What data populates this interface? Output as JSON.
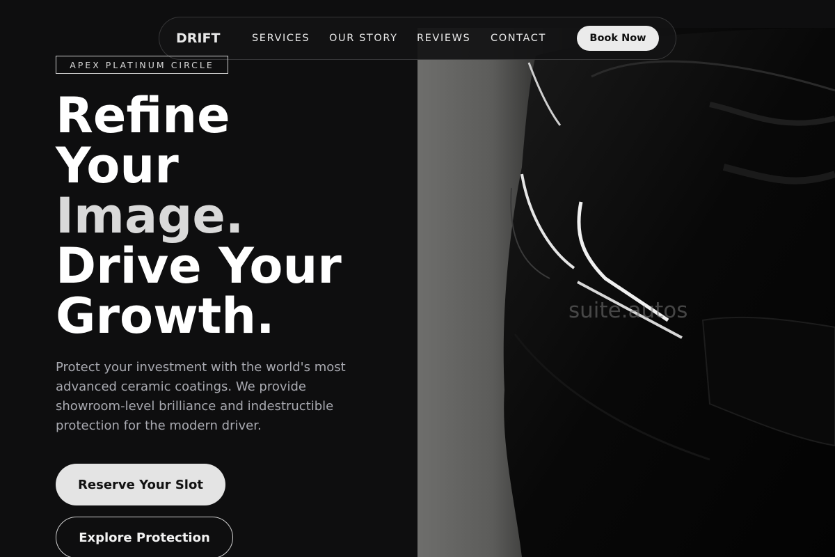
{
  "nav": {
    "logo": "DRIFT",
    "links": [
      "SERVICES",
      "OUR STORY",
      "REVIEWS",
      "CONTACT"
    ],
    "cta": "Book Now"
  },
  "hero": {
    "badge": "APEX PLATINUM CIRCLE",
    "headline_lines": [
      "Refine",
      "Your",
      "Image.",
      "Drive Your",
      "Growth."
    ],
    "description": "Protect your investment with the world's most advanced ceramic coatings. We provide showroom-level brilliance and indestructible protection for the modern driver.",
    "primary_cta": "Reserve Your Slot",
    "secondary_cta": "Explore Protection",
    "image_watermark": "suite.autos",
    "image_subject": "black-car-headlight-photo"
  },
  "colors": {
    "background": "#0e0e0f",
    "text_primary": "#ffffff",
    "text_muted": "#a9aab1",
    "button_light": "#e4e4e4"
  }
}
